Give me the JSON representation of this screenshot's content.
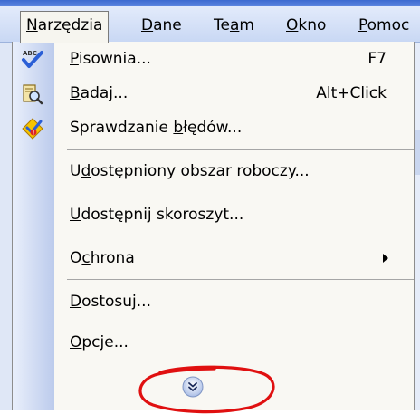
{
  "menubar": {
    "items": [
      {
        "label": "Narzędzia",
        "accel": 0
      },
      {
        "label": "Dane",
        "accel": 0
      },
      {
        "label": "Team",
        "accel": 2
      },
      {
        "label": "Okno",
        "accel": 0
      },
      {
        "label": "Pomoc",
        "accel": 0
      }
    ]
  },
  "menu": {
    "items": [
      {
        "label": "Pisownia...",
        "accel": 0,
        "shortcut": "F7",
        "icon": "spellcheck-icon"
      },
      {
        "label": "Badaj...",
        "accel": 0,
        "shortcut": "Alt+Click",
        "icon": "research-icon"
      },
      {
        "label": "Sprawdzanie błędów...",
        "accel": 12,
        "icon": "error-check-icon"
      },
      {
        "label": "Udostępniony obszar roboczy...",
        "accel": 1
      },
      {
        "label": "Udostępnij skoroszyt...",
        "accel": 0
      },
      {
        "label": "Ochrona",
        "accel": 1,
        "submenu": true
      },
      {
        "label": "Dostosuj...",
        "accel": 0
      },
      {
        "label": "Opcje...",
        "accel": 0
      }
    ],
    "expand_icon": "chevron-double-down-icon"
  },
  "colors": {
    "highlight_circle": "#e01010",
    "menu_background": "#f9f8f3",
    "icon_column": "#bccbec"
  }
}
